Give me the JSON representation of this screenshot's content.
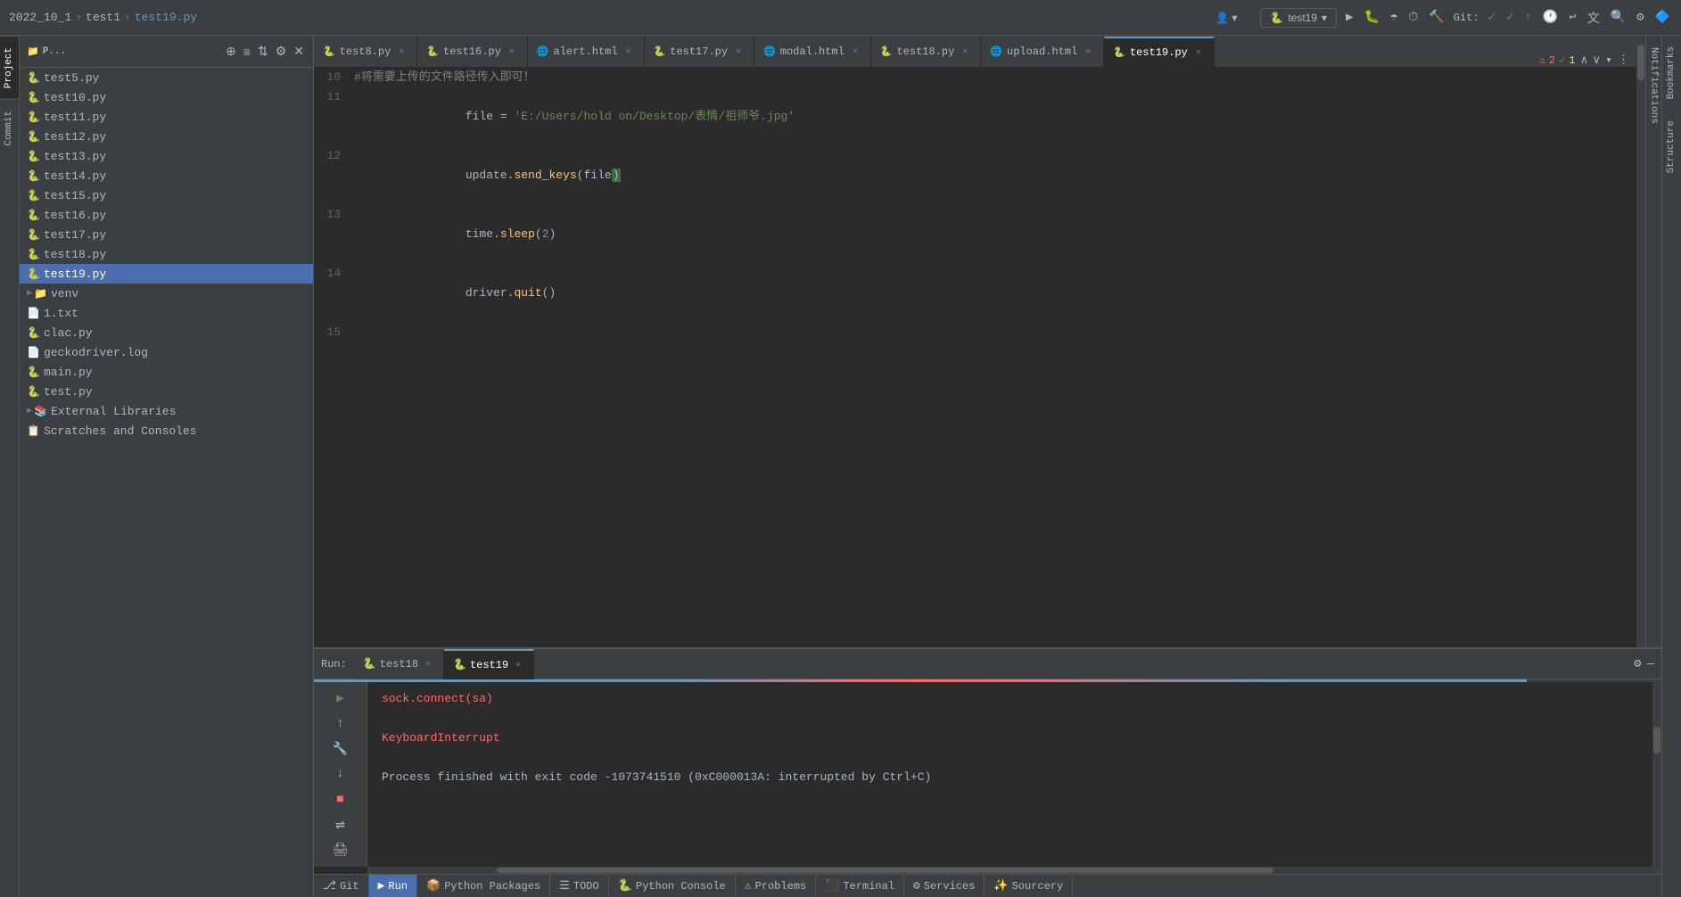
{
  "titlebar": {
    "breadcrumbs": [
      "2022_10_1",
      "test1",
      "test19.py"
    ],
    "run_config": "test19",
    "git_label": "Git:",
    "profile_icon": "👤"
  },
  "tabs": [
    {
      "label": "test8.py",
      "active": false,
      "icon": "🐍"
    },
    {
      "label": "test16.py",
      "active": false,
      "icon": "🐍"
    },
    {
      "label": "alert.html",
      "active": false,
      "icon": "🌐"
    },
    {
      "label": "test17.py",
      "active": false,
      "icon": "🐍"
    },
    {
      "label": "modal.html",
      "active": false,
      "icon": "🌐"
    },
    {
      "label": "test18.py",
      "active": false,
      "icon": "🐍"
    },
    {
      "label": "upload.html",
      "active": false,
      "icon": "🌐"
    },
    {
      "label": "test19.py",
      "active": true,
      "icon": "🐍"
    }
  ],
  "editor": {
    "error_count": "2",
    "warning_count": "1",
    "lines": [
      {
        "num": "10",
        "content": "#将需要上传的文件路径传入即可！",
        "type": "comment"
      },
      {
        "num": "11",
        "content": "file = 'E:/Users/hold on/Desktop/表情/祖师爷.jpg'",
        "type": "string_assign"
      },
      {
        "num": "12",
        "content": "update.send_keys(file)",
        "type": "method_call"
      },
      {
        "num": "13",
        "content": "time.sleep(2)",
        "type": "method_call"
      },
      {
        "num": "14",
        "content": "driver.quit()",
        "type": "method_call"
      },
      {
        "num": "15",
        "content": "",
        "type": "empty"
      }
    ]
  },
  "file_tree": {
    "items": [
      {
        "name": "test5.py",
        "type": "py",
        "indent": 1
      },
      {
        "name": "test10.py",
        "type": "py",
        "indent": 1
      },
      {
        "name": "test11.py",
        "type": "py",
        "indent": 1
      },
      {
        "name": "test12.py",
        "type": "py",
        "indent": 1
      },
      {
        "name": "test13.py",
        "type": "py",
        "indent": 1
      },
      {
        "name": "test14.py",
        "type": "py",
        "indent": 1
      },
      {
        "name": "test15.py",
        "type": "py",
        "indent": 1
      },
      {
        "name": "test16.py",
        "type": "py",
        "indent": 1
      },
      {
        "name": "test17.py",
        "type": "py",
        "indent": 1
      },
      {
        "name": "test18.py",
        "type": "py",
        "indent": 1
      },
      {
        "name": "test19.py",
        "type": "py",
        "indent": 1,
        "selected": true
      },
      {
        "name": "venv",
        "type": "folder",
        "indent": 1,
        "collapsed": true
      },
      {
        "name": "1.txt",
        "type": "txt",
        "indent": 1
      },
      {
        "name": "clac.py",
        "type": "py",
        "indent": 1
      },
      {
        "name": "geckodriver.log",
        "type": "log",
        "indent": 1
      },
      {
        "name": "main.py",
        "type": "py",
        "indent": 1
      },
      {
        "name": "test.py",
        "type": "py",
        "indent": 1
      },
      {
        "name": "External Libraries",
        "type": "special",
        "indent": 0,
        "collapsed": true
      },
      {
        "name": "Scratches and Consoles",
        "type": "special",
        "indent": 0
      }
    ]
  },
  "panel_header": {
    "title": "P..."
  },
  "run_panel": {
    "label": "Run:",
    "tabs": [
      {
        "label": "test18",
        "active": false,
        "icon": "🐍"
      },
      {
        "label": "test19",
        "active": true,
        "icon": "🐍"
      }
    ],
    "output": [
      {
        "text": "sock.connect(sa)",
        "type": "error"
      },
      {
        "text": "",
        "type": "normal"
      },
      {
        "text": "KeyboardInterrupt",
        "type": "error"
      },
      {
        "text": "",
        "type": "normal"
      },
      {
        "text": "Process finished with exit code -1073741510 (0xC000013A: interrupted by Ctrl+C)",
        "type": "normal"
      }
    ]
  },
  "status_bar": {
    "items": [
      {
        "label": "Git",
        "icon": "⎇",
        "active": false
      },
      {
        "label": "Run",
        "icon": "▶",
        "active": true
      },
      {
        "label": "Python Packages",
        "icon": "📦",
        "active": false
      },
      {
        "label": "TODO",
        "icon": "☰",
        "active": false
      },
      {
        "label": "Python Console",
        "icon": "🐍",
        "active": false
      },
      {
        "label": "Problems",
        "icon": "⚠",
        "active": false
      },
      {
        "label": "Terminal",
        "icon": "⬛",
        "active": false
      },
      {
        "label": "Services",
        "icon": "⚙",
        "active": false
      },
      {
        "label": "Sourcery",
        "icon": "✨",
        "active": false
      }
    ]
  },
  "side_panel_tabs": {
    "project_label": "Project",
    "commit_label": "Commit"
  },
  "console_toolbar": {
    "play": "▶",
    "up": "↑",
    "wrench": "🔧",
    "down": "↓",
    "stop": "■",
    "rerun": "↻",
    "print": "🖨"
  },
  "bottom_tabs": {
    "bookmarks": "Bookmarks",
    "structure": "Structure"
  }
}
